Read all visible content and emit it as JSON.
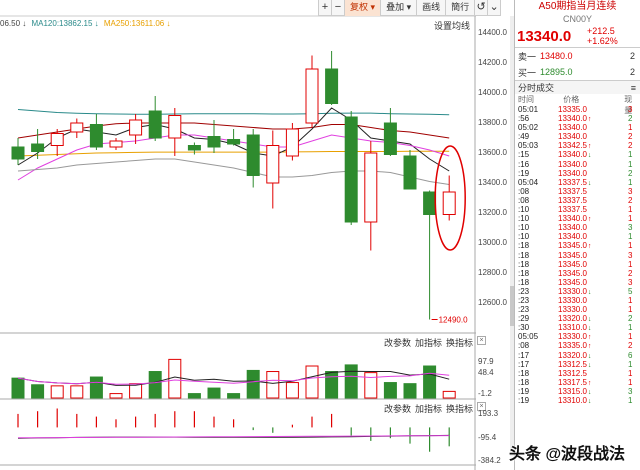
{
  "toolbar": {
    "buttons": [
      "+",
      "−",
      "复权",
      "叠加",
      "画线",
      "簡行",
      "↺"
    ],
    "active_index": 2,
    "more_icon": "⌄"
  },
  "ma_legend": {
    "ma_a": "06.50 ↓",
    "ma120": "MA120:13862.15 ↓",
    "ma250": "MA250:13611.06 ↓"
  },
  "settings_label": "设置均线",
  "price_axis": [
    "14400.0",
    "14200.0",
    "14000.0",
    "13800.0",
    "13600.0",
    "13400.0",
    "13200.0",
    "13000.0",
    "12800.0",
    "12600.0"
  ],
  "low_marker": "12490.0",
  "panel2": {
    "btn1": "改参数",
    "btn2": "加指标",
    "btn3": "换指标",
    "close": "×",
    "axis": [
      "97.9",
      "48.4",
      "-1.2"
    ]
  },
  "panel3": {
    "btn1": "改参数",
    "btn2": "加指标",
    "btn3": "换指标",
    "close": "×",
    "axis": [
      "193.3",
      "-95.4",
      "-384.2"
    ]
  },
  "quote": {
    "title": "A50期指当月连续",
    "code": "CN00Y",
    "price": "13340.0",
    "change": "+212.5",
    "change_pct": "+1.62%",
    "sell_label": "卖一",
    "sell_price": "13480.0",
    "sell_vol": "2",
    "buy_label": "买一",
    "buy_price": "12895.0",
    "buy_vol": "2",
    "ticks_title": "分时成交",
    "ticks_corner": "≡",
    "col_time": "时间",
    "col_price": "价格",
    "col_vol": "现量",
    "rows": [
      {
        "t": "05:01",
        "p": "13335.0",
        "a": "",
        "v": "3",
        "c": "r"
      },
      {
        "t": ":56",
        "p": "13340.0",
        "a": "↑",
        "v": "2",
        "c": "g"
      },
      {
        "t": "05:02",
        "p": "13340.0",
        "a": "",
        "v": "1",
        "c": "r"
      },
      {
        "t": ":49",
        "p": "13340.0",
        "a": "",
        "v": "2",
        "c": "r"
      },
      {
        "t": "05:03",
        "p": "13342.5",
        "a": "↑",
        "v": "2",
        "c": "r"
      },
      {
        "t": ":15",
        "p": "13340.0",
        "a": "↓",
        "v": "1",
        "c": "g"
      },
      {
        "t": ":16",
        "p": "13340.0",
        "a": "",
        "v": "1",
        "c": "g"
      },
      {
        "t": ":19",
        "p": "13340.0",
        "a": "",
        "v": "2",
        "c": "g"
      },
      {
        "t": "05:04",
        "p": "13337.5",
        "a": "↓",
        "v": "1",
        "c": "g"
      },
      {
        "t": ":08",
        "p": "13337.5",
        "a": "",
        "v": "3",
        "c": "r"
      },
      {
        "t": ":08",
        "p": "13337.5",
        "a": "",
        "v": "2",
        "c": "r"
      },
      {
        "t": ":10",
        "p": "13337.5",
        "a": "",
        "v": "1",
        "c": "r"
      },
      {
        "t": ":10",
        "p": "13340.0",
        "a": "↑",
        "v": "1",
        "c": "r"
      },
      {
        "t": ":10",
        "p": "13340.0",
        "a": "",
        "v": "3",
        "c": "g"
      },
      {
        "t": ":10",
        "p": "13340.0",
        "a": "",
        "v": "1",
        "c": "g"
      },
      {
        "t": ":18",
        "p": "13345.0",
        "a": "↑",
        "v": "1",
        "c": "r"
      },
      {
        "t": ":18",
        "p": "13345.0",
        "a": "",
        "v": "3",
        "c": "r"
      },
      {
        "t": ":18",
        "p": "13345.0",
        "a": "",
        "v": "1",
        "c": "r"
      },
      {
        "t": ":18",
        "p": "13345.0",
        "a": "",
        "v": "2",
        "c": "r"
      },
      {
        "t": ":18",
        "p": "13345.0",
        "a": "",
        "v": "3",
        "c": "r"
      },
      {
        "t": ":23",
        "p": "13330.0",
        "a": "↓",
        "v": "5",
        "c": "g"
      },
      {
        "t": ":23",
        "p": "13330.0",
        "a": "",
        "v": "1",
        "c": "r"
      },
      {
        "t": ":23",
        "p": "13330.0",
        "a": "",
        "v": "1",
        "c": "r"
      },
      {
        "t": ":29",
        "p": "13320.0",
        "a": "↓",
        "v": "2",
        "c": "g"
      },
      {
        "t": ":30",
        "p": "13310.0",
        "a": "↓",
        "v": "1",
        "c": "g"
      },
      {
        "t": "05:05",
        "p": "13330.0",
        "a": "↑",
        "v": "1",
        "c": "r"
      },
      {
        "t": ":08",
        "p": "13335.0",
        "a": "↑",
        "v": "2",
        "c": "r"
      },
      {
        "t": ":17",
        "p": "13320.0",
        "a": "↓",
        "v": "6",
        "c": "g"
      },
      {
        "t": ":17",
        "p": "13312.5",
        "a": "↓",
        "v": "1",
        "c": "g"
      },
      {
        "t": ":18",
        "p": "13312.5",
        "a": "",
        "v": "1",
        "c": "r"
      },
      {
        "t": ":18",
        "p": "13317.5",
        "a": "↑",
        "v": "1",
        "c": "r"
      },
      {
        "t": ":19",
        "p": "13315.0",
        "a": "↓",
        "v": "3",
        "c": "g"
      },
      {
        "t": ":19",
        "p": "13310.0",
        "a": "↓",
        "v": "1",
        "c": "g"
      }
    ]
  },
  "watermark": "头条 @波段战法",
  "colors": {
    "up": "#e00000",
    "down": "#2e8b2e",
    "ma_black": "#222222",
    "ma_yellow": "#e8a000",
    "ma_magenta": "#e040e0",
    "ma_red": "#a00000",
    "ma_teal": "#2a8a8a",
    "ma_gray": "#999999",
    "highlight_circle": "#e00000"
  },
  "chart_data": {
    "type": "candlestick",
    "title": "",
    "ylim": [
      12420,
      14500
    ],
    "candles": [
      {
        "o": 13640,
        "h": 13700,
        "l": 13520,
        "c": 13560,
        "v": 36
      },
      {
        "o": 13660,
        "h": 13760,
        "l": 13560,
        "c": 13610,
        "v": 24
      },
      {
        "o": 13650,
        "h": 13760,
        "l": 13580,
        "c": 13730,
        "v": 22
      },
      {
        "o": 13740,
        "h": 13830,
        "l": 13700,
        "c": 13800,
        "v": 22
      },
      {
        "o": 13790,
        "h": 13860,
        "l": 13620,
        "c": 13640,
        "v": 38
      },
      {
        "o": 13640,
        "h": 13700,
        "l": 13620,
        "c": 13680,
        "v": 8
      },
      {
        "o": 13720,
        "h": 13860,
        "l": 13660,
        "c": 13820,
        "v": 26
      },
      {
        "o": 13880,
        "h": 13980,
        "l": 13680,
        "c": 13700,
        "v": 48
      },
      {
        "o": 13700,
        "h": 13900,
        "l": 13580,
        "c": 13850,
        "v": 70
      },
      {
        "o": 13650,
        "h": 13670,
        "l": 13590,
        "c": 13620,
        "v": 8
      },
      {
        "o": 13710,
        "h": 13820,
        "l": 13600,
        "c": 13640,
        "v": 18
      },
      {
        "o": 13690,
        "h": 13760,
        "l": 13650,
        "c": 13660,
        "v": 8
      },
      {
        "o": 13720,
        "h": 13760,
        "l": 13370,
        "c": 13450,
        "v": 50
      },
      {
        "o": 13400,
        "h": 13750,
        "l": 13230,
        "c": 13650,
        "v": 48
      },
      {
        "o": 13580,
        "h": 13800,
        "l": 13550,
        "c": 13760,
        "v": 28
      },
      {
        "o": 13800,
        "h": 14250,
        "l": 13770,
        "c": 14160,
        "v": 58
      },
      {
        "o": 14160,
        "h": 14280,
        "l": 13920,
        "c": 13930,
        "v": 48
      },
      {
        "o": 13840,
        "h": 13880,
        "l": 13120,
        "c": 13140,
        "v": 60
      },
      {
        "o": 13140,
        "h": 13680,
        "l": 12950,
        "c": 13600,
        "v": 46
      },
      {
        "o": 13800,
        "h": 13900,
        "l": 13580,
        "c": 13590,
        "v": 28
      },
      {
        "o": 13580,
        "h": 13620,
        "l": 13360,
        "c": 13360,
        "v": 26
      },
      {
        "o": 13340,
        "h": 13350,
        "l": 12490,
        "c": 13190,
        "v": 58
      },
      {
        "o": 13190,
        "h": 13450,
        "l": 13150,
        "c": 13340,
        "v": 12
      }
    ],
    "volume_ylim": [
      0,
      97.9
    ],
    "macd_ylim": [
      -384.2,
      193.3
    ],
    "macd": [
      5,
      6,
      7,
      5,
      4,
      3,
      4,
      5,
      6,
      6,
      4,
      3,
      -1,
      -2,
      1,
      4,
      5,
      -3,
      -5,
      -4,
      -6,
      -9,
      -7
    ]
  }
}
